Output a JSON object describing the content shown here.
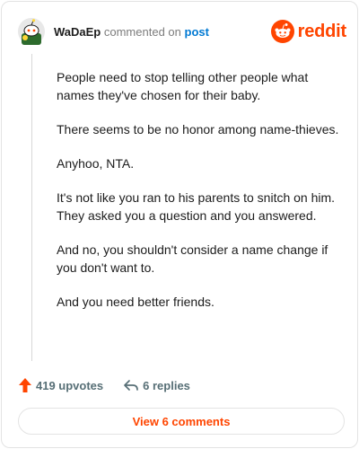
{
  "comment": {
    "author": "WaDaEp",
    "action_text": "commented on",
    "post_link_text": "post",
    "paragraphs": [
      "People need to stop telling other people what names they've chosen for their baby.",
      "There seems to be no honor among name-thieves.",
      "Anyhoo, NTA.",
      "It's not like you ran to his parents to snitch on him. They asked you a question and you answered.",
      "And no, you shouldn't consider a name change if you don't want to.",
      "And you need better friends."
    ],
    "upvotes_text": "419 upvotes",
    "replies_text": "6 replies"
  },
  "brand": {
    "name": "reddit",
    "icon": "reddit-logo-icon",
    "color": "#ff4500"
  },
  "footer": {
    "view_comments_label": "View 6 comments"
  },
  "colors": {
    "accent": "#ff4500",
    "link": "#0079d3",
    "muted": "#576f76"
  }
}
